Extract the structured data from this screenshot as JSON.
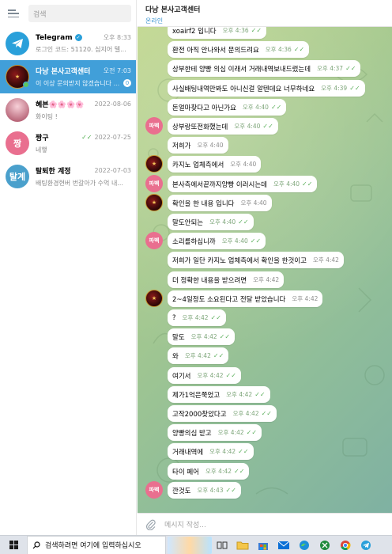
{
  "sidebar": {
    "search_placeholder": "검색",
    "chats": [
      {
        "name": "Telegram",
        "time": "오후 8:33",
        "preview": "로그인 코드: 51120. 심지어 텔...",
        "avatar": "✈"
      },
      {
        "name": "다낭 본사고객센터",
        "time": "오전 7:03",
        "preview": "이 이상 문의받지 않겠습니다 ...",
        "avatar": "",
        "unread": "0"
      },
      {
        "name": "혜븐🌸🌸🌸🌸",
        "time": "2022-08-06",
        "preview": "화이팅 !",
        "avatar": ""
      },
      {
        "name": "짱구",
        "time": "2022-07-25",
        "preview": "네햏",
        "avatar": "짱"
      },
      {
        "name": "탈퇴한 계정",
        "time": "2022-07-03",
        "preview": "배팅환경현버 번갈아가 수억 내...",
        "avatar": "탈계"
      }
    ]
  },
  "header": {
    "title": "다낭 본사고객센터",
    "status": "온라인"
  },
  "messages": [
    {
      "text": "xoairf2 입니다",
      "time": "오후 4:36",
      "check": true
    },
    {
      "text": "환전 아직 안나와서 문의드려요",
      "time": "오후 4:36",
      "check": true
    },
    {
      "text": "상부한테 양빵 의심 이래서 거래내역보내드렸는데",
      "time": "오후 4:37",
      "check": true
    },
    {
      "text": "사실배팅내역만봐도 아니신걸 알텐데요 너무하네요",
      "time": "오후 4:39",
      "check": true
    },
    {
      "text": "돈얼마찾다고 아닌가요",
      "time": "오후 4:40",
      "check": true
    },
    {
      "text": "상부랑또전화했는데",
      "time": "오후 4:40",
      "check": true,
      "avatar": "파벡"
    },
    {
      "text": "저희가",
      "time": "오후 4:40",
      "check": false
    },
    {
      "text": "카지노 업체측에서",
      "time": "오후 4:40",
      "check": false,
      "avatar": "dark"
    },
    {
      "text": "본사측에서끝까지양빵 이러시는데",
      "time": "오후 4:40",
      "check": true,
      "avatar": "파벡"
    },
    {
      "text": "확인을 한 내용 입니다",
      "time": "오후 4:40",
      "check": false,
      "avatar": "dark"
    },
    {
      "text": "말도안되는",
      "time": "오후 4:40",
      "check": true
    },
    {
      "text": "소리를하십니까",
      "time": "오후 4:40",
      "check": true,
      "avatar": "파벡"
    },
    {
      "text": "저희가 일단 카지노 업체측에서 확인을 한것이고",
      "time": "오후 4:42",
      "check": false
    },
    {
      "text": "더 정확한 내용을 받으려면",
      "time": "오후 4:42",
      "check": false
    },
    {
      "text": "2~4일정도 소요된다고 전달 받았습니다",
      "time": "오후 4:42",
      "check": false,
      "avatar": "dark"
    },
    {
      "text": "?",
      "time": "오후 4:42",
      "check": true
    },
    {
      "text": "말도",
      "time": "오후 4:42",
      "check": true
    },
    {
      "text": "와",
      "time": "오후 4:42",
      "check": true
    },
    {
      "text": "여기서",
      "time": "오후 4:42",
      "check": true
    },
    {
      "text": "제가1억은쭉었고",
      "time": "오후 4:42",
      "check": true
    },
    {
      "text": "고작2000찾았다고",
      "time": "오후 4:42",
      "check": true
    },
    {
      "text": "양빵의심 받고",
      "time": "오후 4:42",
      "check": true
    },
    {
      "text": "거래내역에",
      "time": "오후 4:42",
      "check": true
    },
    {
      "text": "타이 페어",
      "time": "오후 4:42",
      "check": true
    },
    {
      "text": "깐것도",
      "time": "오후 4:43",
      "check": true,
      "avatar": "파벡"
    }
  ],
  "composer": {
    "placeholder": "메시지 작성..."
  },
  "taskbar": {
    "search_text": "검색하려면 여기에 입력하십시오"
  }
}
